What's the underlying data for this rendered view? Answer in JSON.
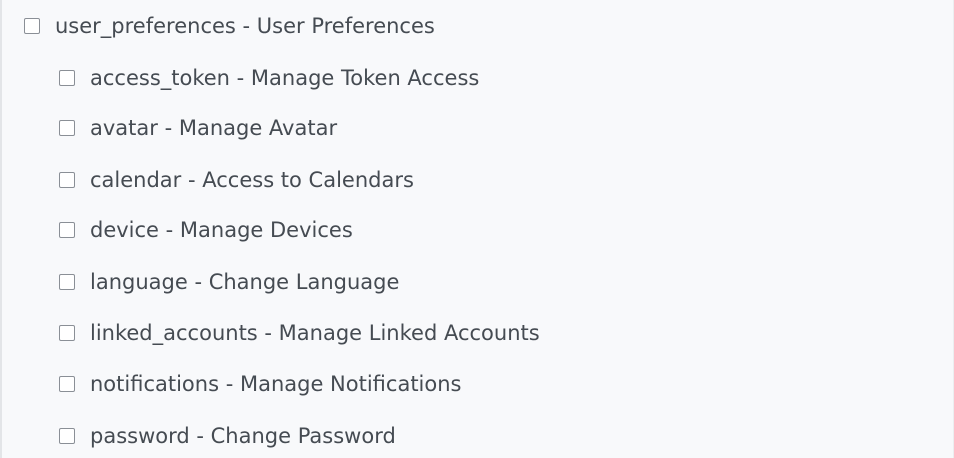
{
  "permissions": {
    "group": {
      "label": "user_preferences - User Preferences",
      "checked": false
    },
    "items": [
      {
        "label": "access_token - Manage Token Access",
        "checked": false
      },
      {
        "label": "avatar - Manage Avatar",
        "checked": false
      },
      {
        "label": "calendar - Access to Calendars",
        "checked": false
      },
      {
        "label": "device - Manage Devices",
        "checked": false
      },
      {
        "label": "language - Change Language",
        "checked": false
      },
      {
        "label": "linked_accounts - Manage Linked Accounts",
        "checked": false
      },
      {
        "label": "notifications - Manage Notifications",
        "checked": false
      },
      {
        "label": "password - Change Password",
        "checked": false
      }
    ]
  },
  "colors": {
    "background": "#f8f9fb",
    "text": "#454b52",
    "checkbox_border": "#8a8f96"
  }
}
